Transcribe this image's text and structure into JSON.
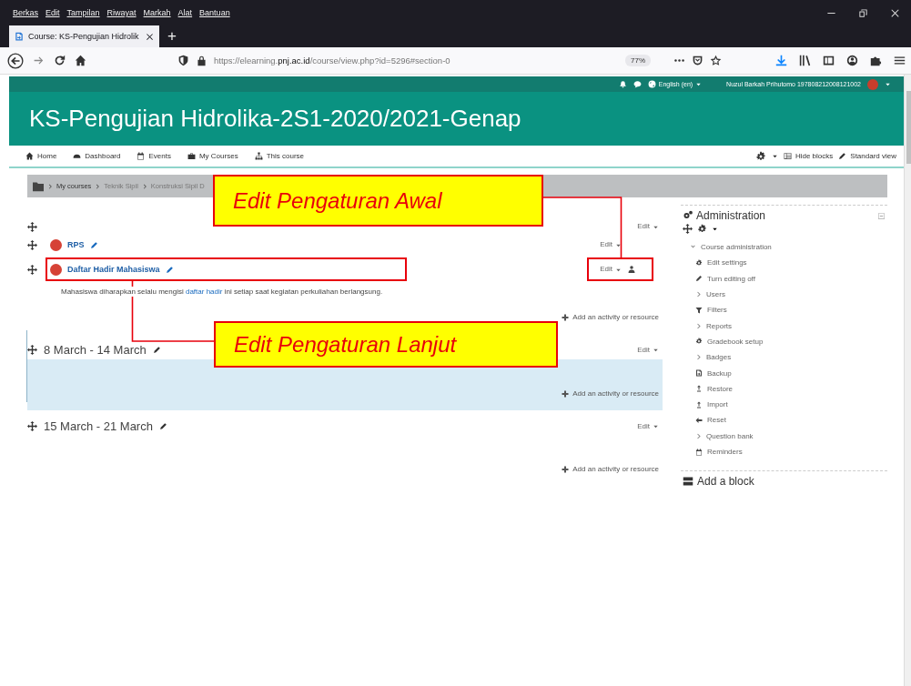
{
  "browser": {
    "menu": [
      "Berkas",
      "Edit",
      "Tampilan",
      "Riwayat",
      "Markah",
      "Alat",
      "Bantuan"
    ],
    "tab": {
      "title": "Course: KS-Pengujian Hidrolik",
      "selected": true
    },
    "new_tab": "+",
    "url": {
      "prefix": "https://elearning.",
      "domain": "pnj.ac.id",
      "path": "/course/view.php?id=5296#section-0"
    },
    "zoom": "77%"
  },
  "top_bar": {
    "language": "English (en)",
    "user": "Nuzul Barkah Prihutomo 197808212008121002"
  },
  "course_title": "KS-Pengujian Hidrolika-2S1-2020/2021-Genap",
  "nav": [
    {
      "label": "Home",
      "kind": "home"
    },
    {
      "label": "Dashboard",
      "kind": "dashboard"
    },
    {
      "label": "Events",
      "kind": "calendar"
    },
    {
      "label": "My Courses",
      "kind": "briefcase"
    },
    {
      "label": "This course",
      "kind": "sitemap"
    }
  ],
  "nav_right": [
    {
      "label": "Hide blocks",
      "kind": "blocks"
    },
    {
      "label": "Standard view",
      "kind": "pencil"
    }
  ],
  "breadcrumb": [
    "My courses",
    "Teknik Sipil",
    "Konstruksi Sipil D"
  ],
  "sections": [
    {
      "current": false,
      "edit": "Edit",
      "add": "Add an activity or resource",
      "activities": [
        {
          "name": "RPS",
          "edit": "Edit"
        },
        {
          "name": "Daftar Hadir Mahasiswa",
          "edit": "Edit",
          "description": [
            {
              "text": "Mahasiswa diharapkan selalu mengisi ",
              "kind": "plain"
            },
            {
              "text": "daftar hadir",
              "kind": "link"
            },
            {
              "text": " ini setiap saat kegiatan perkuliahan berlangsung.",
              "kind": "plain"
            }
          ]
        }
      ]
    },
    {
      "title": "8 March - 14 March",
      "current": true,
      "edit": "Edit",
      "add": "Add an activity or resource"
    },
    {
      "title": "15 March - 21 March",
      "current": false,
      "edit": "Edit",
      "add": "Add an activity or resource"
    }
  ],
  "admin": {
    "title": "Administration",
    "group": {
      "label": "Course administration",
      "expanded": true
    },
    "items": [
      {
        "label": "Edit settings",
        "kind": "gear"
      },
      {
        "label": "Turn editing off",
        "kind": "pencil"
      },
      {
        "label": "Users",
        "kind": "chevron"
      },
      {
        "label": "Filters",
        "kind": "filter"
      },
      {
        "label": "Reports",
        "kind": "chevron"
      },
      {
        "label": "Gradebook setup",
        "kind": "gear"
      },
      {
        "label": "Badges",
        "kind": "chevron"
      },
      {
        "label": "Backup",
        "kind": "file"
      },
      {
        "label": "Restore",
        "kind": "upload"
      },
      {
        "label": "Import",
        "kind": "upload"
      },
      {
        "label": "Reset",
        "kind": "back"
      },
      {
        "label": "Question bank",
        "kind": "chevron"
      },
      {
        "label": "Reminders",
        "kind": "calendar"
      }
    ]
  },
  "add_block": "Add a block",
  "callouts": [
    {
      "text": "Edit Pengaturan Awal"
    },
    {
      "text": "Edit Pengaturan Lanjut"
    }
  ]
}
